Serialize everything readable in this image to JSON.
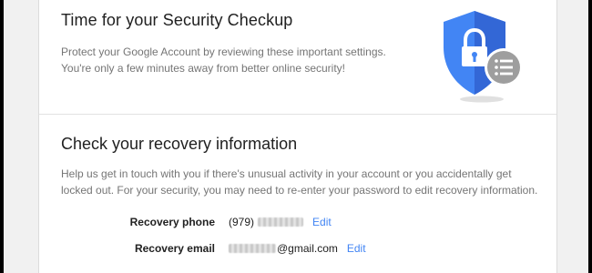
{
  "checkup": {
    "title": "Time for your Security Checkup",
    "description_line1": "Protect your Google Account by reviewing these important settings.",
    "description_line2": "You're only a few minutes away from better online security!",
    "illustration_icon": "shield-lock-icon",
    "badge_icon": "list-icon"
  },
  "recovery": {
    "title": "Check your recovery information",
    "description_line1": "Help us get in touch with you if there's unusual activity in your account or you accidentally get",
    "description_line2": "locked out. For your security, you may need to re-enter your password to edit recovery information.",
    "phone": {
      "label": "Recovery phone",
      "prefix": "(979)",
      "edit_label": "Edit"
    },
    "email": {
      "label": "Recovery email",
      "suffix": "@gmail.com",
      "edit_label": "Edit"
    }
  },
  "colors": {
    "accent": "#4285f4",
    "shield_dark": "#3367d6",
    "badge": "#9e9e9e"
  }
}
